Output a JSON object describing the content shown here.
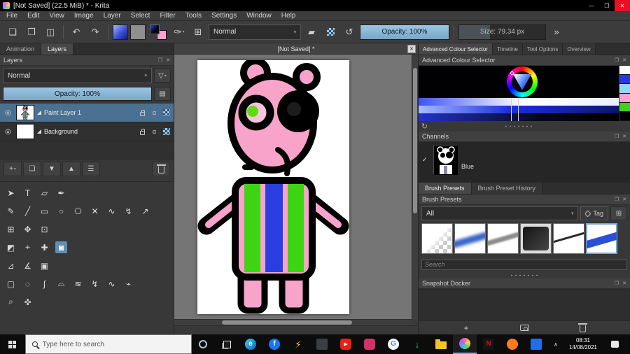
{
  "icons": {
    "minimize": "—",
    "maximize": "❐",
    "close": "✕",
    "float": "❐",
    "new_doc": "❏",
    "open_doc": "❒",
    "save_doc": "◫",
    "undo": "↶",
    "redo": "↷",
    "brush_editor": "✑",
    "grid": "⊞",
    "chevron": "▾",
    "eraser": "▰",
    "reload": "↺",
    "overflow": "»",
    "funnel": "▽",
    "properties": "▤",
    "eye": "◎",
    "alpha": "α",
    "add": "+",
    "duplicate": "❏",
    "move_down": "▼",
    "move_up": "▲",
    "menu": "☰",
    "refresh": "↻",
    "check": "✓",
    "plus": "+",
    "caret_up": "∧"
  },
  "titlebar": {
    "title": "[Not Saved] (22.5 MiB) * - Krita"
  },
  "menubar": {
    "items": [
      "File",
      "Edit",
      "View",
      "Image",
      "Layer",
      "Select",
      "Filter",
      "Tools",
      "Settings",
      "Window",
      "Help"
    ]
  },
  "toolbar": {
    "blending_mode": "Normal",
    "opacity": "Opacity: 100%",
    "size": "Size: 79.34 px"
  },
  "left": {
    "tabs": [
      {
        "label": "Animation"
      },
      {
        "label": "Layers"
      }
    ],
    "layers_docker": {
      "title": "Layers",
      "blending_mode": "Normal",
      "opacity": "Opacity: 100%",
      "layers": [
        {
          "name": "Paint Layer 1"
        },
        {
          "name": "Background"
        }
      ]
    },
    "toolbox": {
      "rows": [
        [
          {
            "name": "shape-select-tool",
            "glyph": "➤"
          },
          {
            "name": "text-tool",
            "glyph": "T"
          },
          {
            "name": "edit-shapes-tool",
            "glyph": "▱"
          },
          {
            "name": "calligraphy-tool",
            "glyph": "✒"
          }
        ],
        [
          {
            "name": "freehand-brush-tool",
            "glyph": "✎"
          },
          {
            "name": "line-tool",
            "glyph": "╱"
          },
          {
            "name": "rectangle-tool",
            "glyph": "▭"
          },
          {
            "name": "ellipse-tool",
            "glyph": "○"
          },
          {
            "name": "polygon-tool",
            "glyph": "⎔"
          },
          {
            "name": "polyline-tool",
            "glyph": "✕"
          },
          {
            "name": "bezier-curve-tool",
            "glyph": "∿"
          },
          {
            "name": "dynamic-brush-tool",
            "glyph": "↯"
          },
          {
            "name": "multibrush-tool",
            "glyph": "↗"
          }
        ],
        [
          {
            "name": "transform-tool",
            "glyph": "⊞"
          },
          {
            "name": "move-tool",
            "glyph": "✥"
          },
          {
            "name": "crop-tool",
            "glyph": "⊡"
          }
        ],
        [
          {
            "name": "gradient-tool",
            "glyph": "◩"
          },
          {
            "name": "color-sampler-tool",
            "glyph": "⌖"
          },
          {
            "name": "smart-patch-tool",
            "glyph": "✚"
          },
          {
            "name": "fill-tool",
            "glyph": "◙",
            "active": true
          }
        ],
        [
          {
            "name": "assistants-tool",
            "glyph": "⊿"
          },
          {
            "name": "measure-tool",
            "glyph": "∡"
          },
          {
            "name": "reference-images-tool",
            "glyph": "▣"
          }
        ],
        [
          {
            "name": "rect-select-tool",
            "glyph": "▢"
          },
          {
            "name": "ellipse-select-tool",
            "glyph": "◌"
          },
          {
            "name": "freehand-select-tool",
            "glyph": "∫"
          },
          {
            "name": "polygon-select-tool",
            "glyph": "⌓"
          },
          {
            "name": "similar-select-tool",
            "glyph": "≋"
          },
          {
            "name": "contiguous-select-tool",
            "glyph": "↯"
          },
          {
            "name": "path-select-tool",
            "glyph": "∿"
          },
          {
            "name": "magnetic-select-tool",
            "glyph": "⌁"
          }
        ],
        [
          {
            "name": "zoom-tool",
            "glyph": "⌕"
          },
          {
            "name": "pan-tool",
            "glyph": "✜"
          }
        ]
      ]
    }
  },
  "canvas": {
    "tab_title": "[Not Saved] *"
  },
  "right": {
    "tabs": [
      {
        "label": "Advanced Colour Selector"
      },
      {
        "label": "Timeline"
      },
      {
        "label": "Tool Options"
      },
      {
        "label": "Overview"
      }
    ],
    "color_docker": {
      "title": "Advanced Colour Selector"
    },
    "palette": [
      "#ffffff",
      "#2438e8",
      "#8fd8ff",
      "#ff9fd2",
      "#3fd215",
      "#000000"
    ],
    "channels": {
      "title": "Channels",
      "rows": [
        {
          "name": "Blue"
        }
      ]
    },
    "brush_tabs": [
      {
        "label": "Brush Presets"
      },
      {
        "label": "Brush Preset History"
      }
    ],
    "brush_docker": {
      "title": "Brush Presets",
      "filter": "All",
      "tag": "Tag",
      "search_placeholder": "Search"
    },
    "snapshot_docker": {
      "title": "Snapshot Docker"
    }
  },
  "taskbar": {
    "search_placeholder": "Type here to search",
    "clock": {
      "time": "08:31",
      "date": "14/08/2021"
    },
    "apps": [
      {
        "name": "edge-icon",
        "shape": "circle",
        "bg": "linear-gradient(135deg,#35d2f2,#0b68c3)",
        "glyph": "e",
        "fg": "#ffffff"
      },
      {
        "name": "facebook-icon",
        "shape": "circle",
        "bg": "#1877f2",
        "glyph": "f",
        "fg": "#ffffff"
      },
      {
        "name": "lightning-app-icon",
        "shape": "none",
        "bg": "",
        "glyph": "⚡",
        "fg": "#f5c518"
      },
      {
        "name": "dark-app-icon",
        "shape": "square",
        "bg": "#3a3f44",
        "glyph": "",
        "fg": ""
      },
      {
        "name": "youtube-icon",
        "shape": "rounded",
        "bg": "#e62117",
        "glyph": "▶",
        "fg": "#ffffff"
      },
      {
        "name": "red-app-icon",
        "shape": "rounded",
        "bg": "#d6306a",
        "glyph": "",
        "fg": ""
      },
      {
        "name": "google-icon",
        "shape": "circle",
        "bg": "#ffffff",
        "glyph": "G",
        "fg": "#4285f4"
      },
      {
        "name": "downloads-icon",
        "shape": "none",
        "bg": "",
        "glyph": "↓",
        "fg": "#35c24a"
      },
      {
        "name": "file-explorer-icon",
        "shape": "folder",
        "bg": "#f8c12c",
        "glyph": "",
        "fg": ""
      },
      {
        "name": "krita-icon",
        "shape": "circle",
        "bg": "conic-gradient(#ff5daa,#ffd34d,#58d65a,#3fb6ff,#b55cff,#ff5daa)",
        "glyph": "",
        "fg": "",
        "running": true
      },
      {
        "name": "netflix-icon",
        "shape": "square",
        "bg": "#141414",
        "glyph": "N",
        "fg": "#e50914"
      },
      {
        "name": "orange-app-icon",
        "shape": "circle",
        "bg": "#ff7a1a",
        "glyph": "",
        "fg": ""
      },
      {
        "name": "blue-app-icon",
        "shape": "square",
        "bg": "#1f6fe5",
        "glyph": "",
        "fg": "#ffffff"
      }
    ]
  }
}
